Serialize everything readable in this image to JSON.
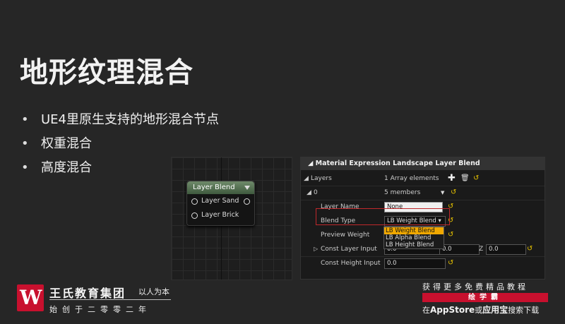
{
  "slide": {
    "title": "地形纹理混合",
    "bullets": [
      "UE4里原生支持的地形混合节点",
      "权重混合",
      "高度混合"
    ]
  },
  "node": {
    "title": "Layer Blend",
    "pins": [
      "Layer Sand",
      "Layer Brick"
    ]
  },
  "details": {
    "title": "Material Expression Landscape Layer Blend",
    "layers_label": "Layers",
    "layers_value": "1 Array elements",
    "index_label": "0",
    "index_value": "5 members",
    "layer_name_label": "Layer Name",
    "layer_name_value": "None",
    "blend_type_label": "Blend Type",
    "blend_type_value": "LB Weight Blend",
    "blend_options": [
      "LB Weight Blend",
      "LB Alpha Blend",
      "LB Height Blend"
    ],
    "preview_weight_label": "Preview Weight",
    "const_layer_label": "Const Layer Input",
    "const_layer_x": "0.0",
    "const_layer_y": "0.0",
    "const_layer_z": "0.0",
    "z_label": "Z",
    "const_height_label": "Const Height Input",
    "const_height_value": "0.0"
  },
  "footer": {
    "logo_glyph": "W",
    "org_name": "王氏教育集团",
    "slogan": "以人为本",
    "since": "始创于二零零二年",
    "ad_line1": "获得更多免费精品教程",
    "ad_badge": "绘学霸",
    "ad_line3_prefix": "在",
    "ad_line3_store": "AppStore",
    "ad_line3_or": "或",
    "ad_line3_app": "应用宝",
    "ad_line3_suffix": "搜索下载"
  },
  "colors": {
    "accent_red": "#c8102e",
    "dropdown_selected": "#f0a800",
    "reset_yellow": "#e6c200"
  }
}
